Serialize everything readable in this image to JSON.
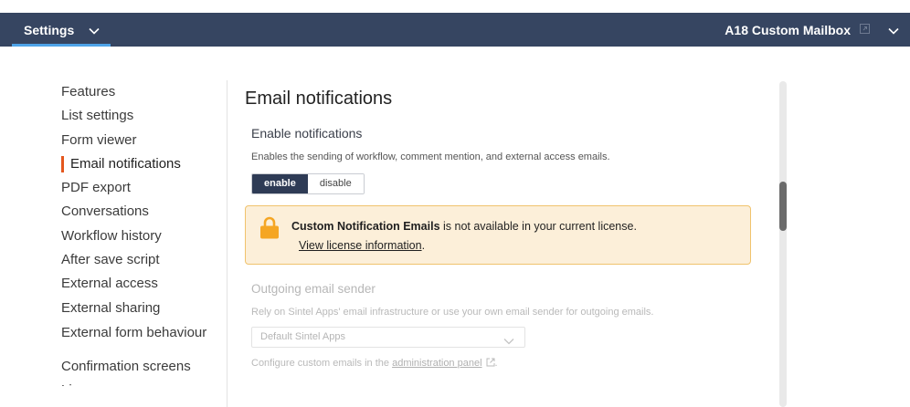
{
  "topbar": {
    "settings_label": "Settings",
    "mailbox_label": "A18 Custom Mailbox",
    "colors": {
      "background": "#364561",
      "underline": "#4ea3e8"
    }
  },
  "sidebar": {
    "items": [
      {
        "label": "Features"
      },
      {
        "label": "List settings"
      },
      {
        "label": "Form viewer"
      },
      {
        "label": "Email notifications",
        "active": true
      },
      {
        "label": "PDF export"
      },
      {
        "label": "Conversations"
      },
      {
        "label": "Workflow history"
      },
      {
        "label": "After save script"
      },
      {
        "label": "External access"
      },
      {
        "label": "External sharing"
      },
      {
        "label": "External form behaviour"
      },
      {
        "label": "Confirmation screens"
      },
      {
        "label": "Li"
      }
    ],
    "active_color": "#e4571e"
  },
  "main": {
    "title": "Email notifications",
    "section_title": "Enable notifications",
    "section_desc": "Enables the sending of workflow, comment mention, and external access emails.",
    "toggle": {
      "enable_label": "enable",
      "disable_label": "disable",
      "selected": "enable"
    }
  },
  "notice": {
    "bold_text": "Custom Notification Emails",
    "text": " is not available in your current license.",
    "link_text": "View license information",
    "link_suffix": ".",
    "icon": "lock-icon",
    "colors": {
      "background": "#fcefd9",
      "border": "#f0c36d",
      "icon": "#f5a623"
    }
  },
  "sender": {
    "title": "Outgoing email sender",
    "desc": "Rely on Sintel Apps' email infrastructure or use your own email sender for outgoing emails.",
    "select_value": "Default Sintel Apps",
    "config_prefix": "Configure custom emails in the ",
    "config_link": "administration panel",
    "config_suffix": "."
  }
}
